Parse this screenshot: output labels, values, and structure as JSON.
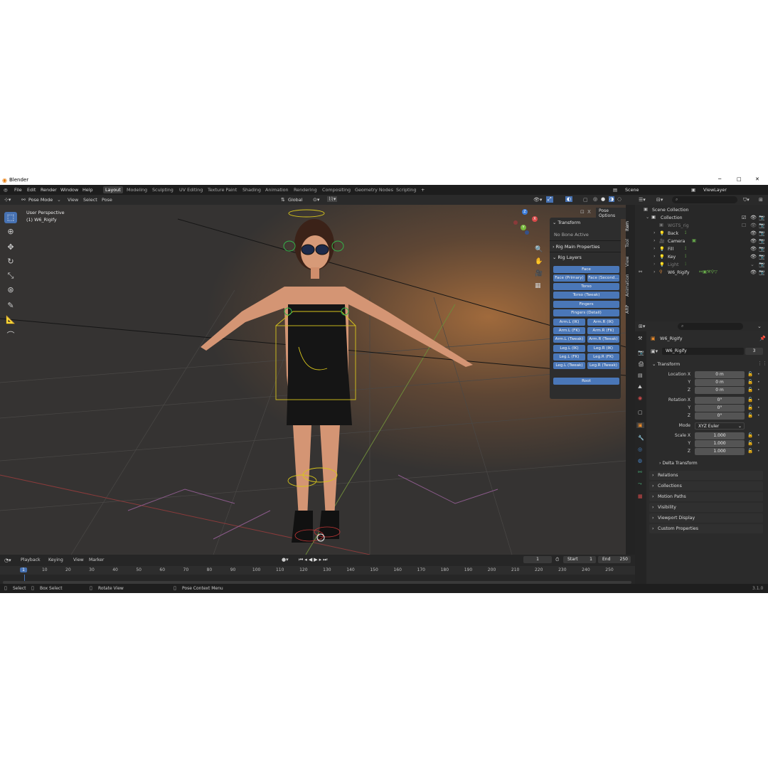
{
  "window": {
    "title": "Blender",
    "min": "─",
    "max": "□",
    "close": "✕"
  },
  "menubar": {
    "menus": [
      "File",
      "Edit",
      "Render",
      "Window",
      "Help"
    ],
    "workspaces": [
      "Layout",
      "Modeling",
      "Sculpting",
      "UV Editing",
      "Texture Paint",
      "Shading",
      "Animation",
      "Rendering",
      "Compositing",
      "Geometry Nodes",
      "Scripting"
    ],
    "add_workspace": "+",
    "scene": "Scene",
    "view_layer": "ViewLayer"
  },
  "viewport_header": {
    "mode": "Pose Mode",
    "menus": [
      "View",
      "Select",
      "Pose"
    ],
    "orientation": "Global",
    "pose_options": "Pose Options"
  },
  "viewport": {
    "perspective": "User Perspective",
    "object": "(1) W6_Rigify",
    "gizmo": {
      "x": "X",
      "y": "Y",
      "z": "Z"
    }
  },
  "npanel": {
    "transform_header": "Transform",
    "no_bone": "No Bone Active",
    "rig_main": "Rig Main Properties",
    "rig_layers": "Rig Layers",
    "layers_full": [
      "Face"
    ],
    "layers_pair1": [
      "Face (Primary)",
      "Face (Second..."
    ],
    "layers_full2": [
      "Torso",
      "Torso (Tweak)",
      "Fingers",
      "Fingers (Detail)"
    ],
    "layers_pairs": [
      [
        "Arm.L (IK)",
        "Arm.R (IK)"
      ],
      [
        "Arm.L (FK)",
        "Arm.R (FK)"
      ],
      [
        "Arm.L (Tweak)",
        "Arm.R (Tweak)"
      ],
      [
        "Leg.L (IK)",
        "Leg.R (IK)"
      ],
      [
        "Leg.L (FK)",
        "Leg.R (FK)"
      ],
      [
        "Leg.L (Tweak)",
        "Leg.R (Tweak)"
      ]
    ],
    "root": "Root",
    "tabs": [
      "Item",
      "Tool",
      "View",
      "Animation",
      "ARP"
    ]
  },
  "timeline": {
    "menus": [
      "Playback",
      "Keying",
      "View",
      "Marker"
    ],
    "current_frame": "1",
    "start_label": "Start",
    "start": "1",
    "end_label": "End",
    "end": "250",
    "ticks": [
      "1",
      "10",
      "20",
      "30",
      "40",
      "50",
      "60",
      "70",
      "80",
      "90",
      "100",
      "110",
      "120",
      "130",
      "140",
      "150",
      "160",
      "170",
      "180",
      "190",
      "200",
      "210",
      "220",
      "230",
      "240",
      "250"
    ]
  },
  "statusbar": {
    "select": "Select",
    "box_select": "Box Select",
    "rotate": "Rotate View",
    "context": "Pose Context Menu",
    "version": "3.1.0"
  },
  "outliner": {
    "scene_collection": "Scene Collection",
    "items": [
      {
        "name": "Collection",
        "dim": false
      },
      {
        "name": "WGTS_rig",
        "dim": true
      },
      {
        "name": "Back",
        "dim": false
      },
      {
        "name": "Camera",
        "dim": false
      },
      {
        "name": "Fill",
        "dim": false
      },
      {
        "name": "Key",
        "dim": false
      },
      {
        "name": "Light",
        "dim": true
      },
      {
        "name": "W6_Rigify",
        "dim": false
      }
    ]
  },
  "properties": {
    "object_name": "W6_Rigify",
    "data_name": "W6_Rigify",
    "users": "3",
    "transform": "Transform",
    "location": {
      "label": "Location X",
      "x": "0 m",
      "y": "0 m",
      "z": "0 m"
    },
    "rotation": {
      "label": "Rotation X",
      "x": "0°",
      "y": "0°",
      "z": "0°"
    },
    "mode_label": "Mode",
    "mode": "XYZ Euler",
    "scale": {
      "label": "Scale X",
      "x": "1.000",
      "y": "1.000",
      "z": "1.000"
    },
    "axis_y": "Y",
    "axis_z": "Z",
    "delta": "Delta Transform",
    "sections": [
      "Relations",
      "Collections",
      "Motion Paths",
      "Visibility",
      "Viewport Display",
      "Custom Properties"
    ]
  },
  "colors": {
    "accent": "#4772b3",
    "layer_button": "#4a77b8",
    "bg": "#232323"
  }
}
